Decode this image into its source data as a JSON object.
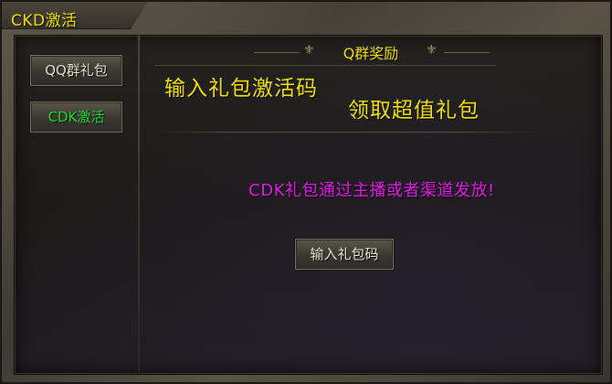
{
  "window": {
    "title": "CKD激活"
  },
  "sidebar": {
    "items": [
      {
        "label": "QQ群礼包",
        "color": "#e8e2d0"
      },
      {
        "label": "CDK激活",
        "color": "#19e02c",
        "active": true
      }
    ]
  },
  "main": {
    "section_title": "Q群奖励",
    "promo_line_1": "输入礼包激活码",
    "promo_line_2": "领取超值礼包",
    "notice": "CDK礼包通过主播或者渠道发放!",
    "redeem_button": "输入礼包码"
  },
  "colors": {
    "title_yellow": "#f2e200",
    "notice_magenta": "#e020e6",
    "active_green": "#19e02c"
  }
}
